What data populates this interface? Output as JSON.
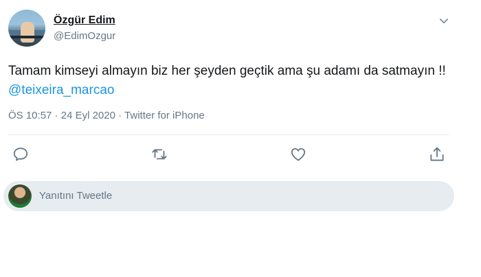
{
  "author": {
    "name": "Özgür Edim",
    "handle": "@EdimOzgur"
  },
  "tweet": {
    "text": "Tamam kimseyi almayın biz her şeyden geçtik ama şu adamı da satmayın !! ",
    "mention": "@teixeira_marcao",
    "time": "ÖS 10:57",
    "separator1": " · ",
    "date": "24 Eyl 2020",
    "separator2": " · ",
    "source": "Twitter for iPhone"
  },
  "actions": {
    "reply_icon": "reply-icon",
    "retweet_icon": "retweet-icon",
    "like_icon": "heart-icon",
    "share_icon": "share-icon",
    "icon_color": "#657786"
  },
  "reply_box": {
    "placeholder": "Yanıtını Tweetle"
  },
  "colors": {
    "link": "#1b95e0",
    "secondary_text": "#657786",
    "reply_bg": "#e6ecf0"
  }
}
